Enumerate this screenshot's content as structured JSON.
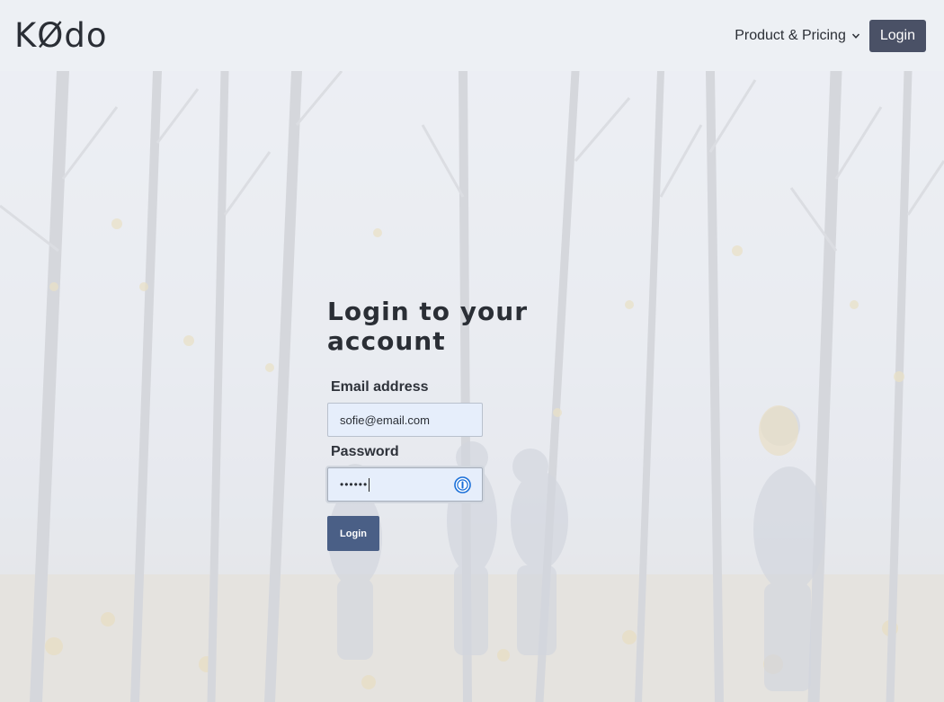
{
  "header": {
    "logo": "KØdo",
    "nav_dropdown_label": "Product & Pricing",
    "login_label": "Login"
  },
  "form": {
    "title": "Login to your account",
    "email_label": "Email address",
    "email_value": "sofie@email.com",
    "password_label": "Password",
    "password_masked": "••••••",
    "submit_label": "Login"
  },
  "icons": {
    "dropdown": "chevron-down-icon",
    "password_manager": "password-manager-icon"
  },
  "colors": {
    "header_bg": "#edf0f4",
    "login_button": "#4a5166",
    "submit_button": "#4a5f86",
    "input_bg": "#e6eefb"
  }
}
